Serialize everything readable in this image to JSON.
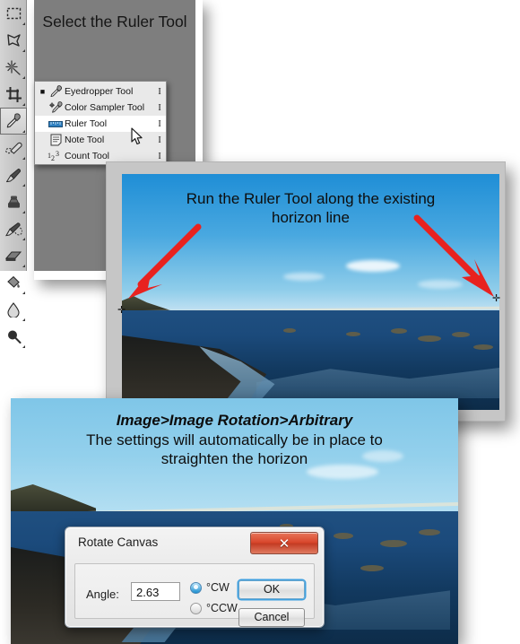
{
  "toolbar": {
    "name": "photoshop-tool-palette",
    "tools": [
      {
        "name": "marquee-tool",
        "glyph": "▭"
      },
      {
        "name": "lasso-tool",
        "glyph": "✦"
      },
      {
        "name": "magic-wand-tool",
        "glyph": "✷"
      },
      {
        "name": "crop-tool",
        "glyph": "⌗"
      },
      {
        "name": "eyedropper-tool",
        "glyph": "⚲",
        "selected": true
      },
      {
        "name": "healing-brush-tool",
        "glyph": "✎"
      },
      {
        "name": "brush-tool",
        "glyph": "✒"
      },
      {
        "name": "clone-stamp-tool",
        "glyph": "⎙"
      },
      {
        "name": "history-brush-tool",
        "glyph": "❧"
      },
      {
        "name": "eraser-tool",
        "glyph": "▰"
      },
      {
        "name": "paint-bucket-tool",
        "glyph": "◓"
      },
      {
        "name": "blur-tool",
        "glyph": "☂"
      },
      {
        "name": "dodge-tool",
        "glyph": "◍"
      }
    ]
  },
  "panel_gray": {
    "caption": "Select the Ruler Tool"
  },
  "flyout_menu": {
    "items": [
      {
        "label": "Eyedropper Tool",
        "shortcut": "I",
        "icon": "eyedropper-icon",
        "active": true,
        "highlighted": false
      },
      {
        "label": "Color Sampler Tool",
        "shortcut": "I",
        "icon": "color-sampler-icon",
        "active": false,
        "highlighted": false
      },
      {
        "label": "Ruler Tool",
        "shortcut": "I",
        "icon": "ruler-icon",
        "active": false,
        "highlighted": true
      },
      {
        "label": "Note Tool",
        "shortcut": "I",
        "icon": "note-icon",
        "active": false,
        "highlighted": false
      },
      {
        "label": "Count Tool",
        "shortcut": "I",
        "icon": "count-icon",
        "active": false,
        "highlighted": false
      }
    ]
  },
  "panel_ruler": {
    "caption_line1": "Run the Ruler Tool along the existing",
    "caption_line2": "horizon line",
    "annotation_arrows": [
      "arrow-left-red",
      "arrow-right-red"
    ],
    "ruler_endpoints": [
      "ruler-endpoint-left",
      "ruler-endpoint-right"
    ]
  },
  "panel_rotate": {
    "caption_line1": "Image>Image Rotation>Arbitrary",
    "caption_line2": "The settings will automatically be in place to",
    "caption_line3": "straighten the horizon"
  },
  "dialog": {
    "title": "Rotate Canvas",
    "close_label": "✕",
    "angle_label": "Angle:",
    "angle_value": "2.63",
    "radio_cw": "°CW",
    "radio_ccw": "°CCW",
    "selected_direction": "°CW",
    "ok_label": "OK",
    "cancel_label": "Cancel"
  },
  "colors": {
    "panel_gray": "#7e7e7e",
    "highlight_row": "#ffffff",
    "arrow_red": "#e8221f",
    "close_red": "#d8452b",
    "ok_focus_blue": "#3fa0e0",
    "sky_blue": "#49a8e0",
    "sea_blue": "#1b4a7b"
  }
}
